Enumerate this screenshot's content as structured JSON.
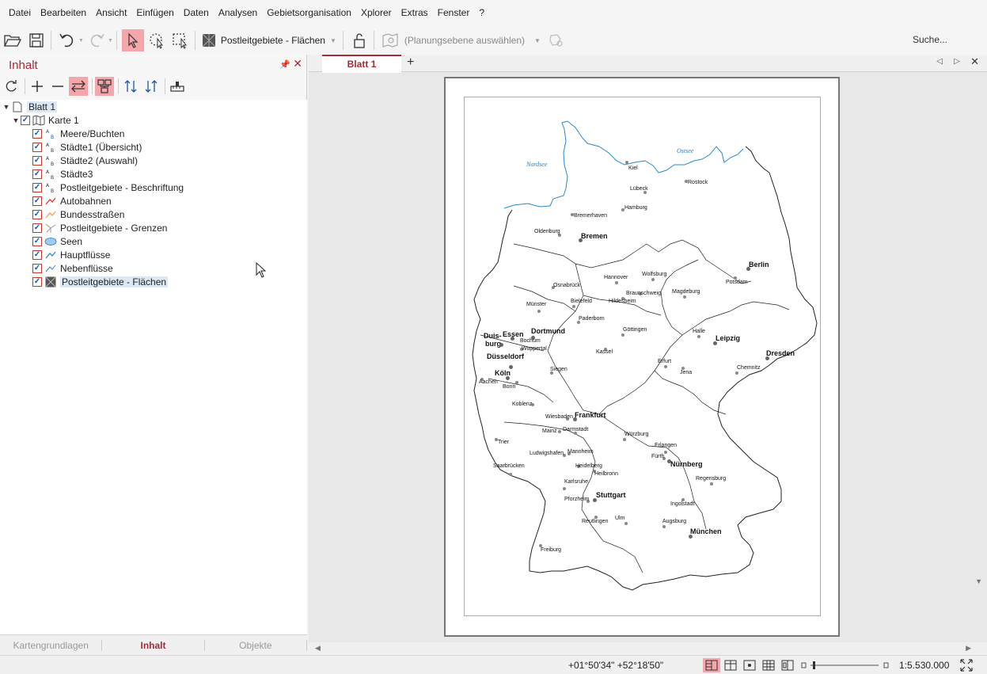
{
  "menu": [
    "Datei",
    "Bearbeiten",
    "Ansicht",
    "Einfügen",
    "Daten",
    "Analysen",
    "Gebietsorganisation",
    "Xplorer",
    "Extras",
    "Fenster",
    "?"
  ],
  "toolbar": {
    "layer_combo": "Postleitgebiete - Flächen",
    "planning_combo": "(Planungsebene auswählen)",
    "search": "Suche..."
  },
  "panel": {
    "title": "Inhalt",
    "tree": {
      "sheet": "Blatt 1",
      "map": "Karte 1",
      "layers": [
        {
          "label": "Meere/Buchten",
          "icon": "text-layer-icon"
        },
        {
          "label": "Städte1 (Übersicht)",
          "icon": "text-layer-icon"
        },
        {
          "label": "Städte2 (Auswahl)",
          "icon": "text-layer-icon"
        },
        {
          "label": "Städte3",
          "icon": "text-layer-icon"
        },
        {
          "label": "Postleitgebiete - Beschriftung",
          "icon": "text-layer-icon"
        },
        {
          "label": "Autobahnen",
          "icon": "red-line-icon"
        },
        {
          "label": "Bundesstraßen",
          "icon": "orange-line-icon"
        },
        {
          "label": "Postleitgebiete - Grenzen",
          "icon": "border-line-icon"
        },
        {
          "label": "Seen",
          "icon": "lake-icon"
        },
        {
          "label": "Hauptflüsse",
          "icon": "river-icon"
        },
        {
          "label": "Nebenflüsse",
          "icon": "river-icon"
        },
        {
          "label": "Postleitgebiete - Flächen",
          "icon": "area-layer-icon"
        }
      ]
    },
    "tabs": [
      "Kartengrundlagen",
      "Inhalt",
      "Objekte"
    ]
  },
  "document": {
    "tab": "Blatt 1"
  },
  "map": {
    "seas": [
      "Nordsee",
      "Ostsee"
    ],
    "cities_big": [
      "Bremen",
      "Berlin",
      "Essen",
      "Dortmund",
      "Duis-",
      "burg",
      "Düsseldorf",
      "Köln",
      "Leipzig",
      "Dresden",
      "Frankfurt",
      "Nürnberg",
      "Stuttgart",
      "München"
    ],
    "cities": [
      "Kiel",
      "Lübeck",
      "Rostock",
      "Hamburg",
      "Bremerhaven",
      "Oldenburg",
      "Potsdam",
      "Hannover",
      "Wolfsburg",
      "Osnabrück",
      "Braunschweig",
      "Magdeburg",
      "Bielefeld",
      "Hildesheim",
      "Münster",
      "Paderborn",
      "Bochum",
      "Wuppertal",
      "Göttingen",
      "Halle",
      "Kassel",
      "Erfurt",
      "Jena",
      "Chemnitz",
      "Siegen",
      "Aachen",
      "Bonn",
      "Koblenz",
      "Wiesbaden",
      "Mainz",
      "Darmstadt",
      "Würzburg",
      "Erlangen",
      "Fürth",
      "Trier",
      "Ludwigshafen",
      "Mannheim",
      "Saarbrücken",
      "Heidelberg",
      "Heilbronn",
      "Regensburg",
      "Karlsruhe",
      "Pforzheim",
      "Ingolstadt",
      "Reutlingen",
      "Ulm",
      "Augsburg",
      "Freiburg"
    ]
  },
  "status": {
    "coords": "+01°50'34\" +52°18'50\"",
    "scale": "1:5.530.000"
  }
}
